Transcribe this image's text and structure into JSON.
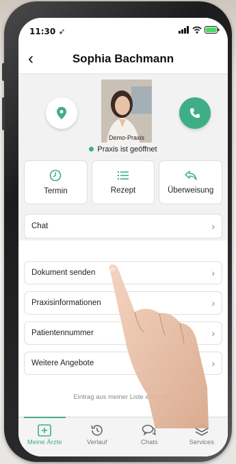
{
  "status_bar": {
    "time": "11:30"
  },
  "header": {
    "title": "Sophia Bachmann",
    "back_icon": "chevron-left-icon"
  },
  "profile": {
    "photo_caption": "Demo-Praxis",
    "practice_status": "Praxis ist geöffnet",
    "status_color": "#3fae86"
  },
  "actions": [
    {
      "label": "Termin",
      "icon": "clock-icon"
    },
    {
      "label": "Rezept",
      "icon": "list-icon"
    },
    {
      "label": "Überweisung",
      "icon": "forward-icon"
    }
  ],
  "chat_row": {
    "label": "Chat"
  },
  "menu": [
    {
      "label": "Dokument senden"
    },
    {
      "label": "Praxisinformationen"
    },
    {
      "label": "Patientennummer"
    },
    {
      "label": "Weitere Angebote"
    }
  ],
  "footer_link": "Eintrag aus meiner Liste entfernen",
  "tabs": [
    {
      "label": "Meine Ärzte",
      "icon": "plus-square-icon",
      "active": true
    },
    {
      "label": "Verlauf",
      "icon": "history-icon",
      "active": false
    },
    {
      "label": "Chats",
      "icon": "chat-bubbles-icon",
      "active": false
    },
    {
      "label": "Services",
      "icon": "layers-icon",
      "active": false
    }
  ],
  "accent_color": "#3fae86"
}
